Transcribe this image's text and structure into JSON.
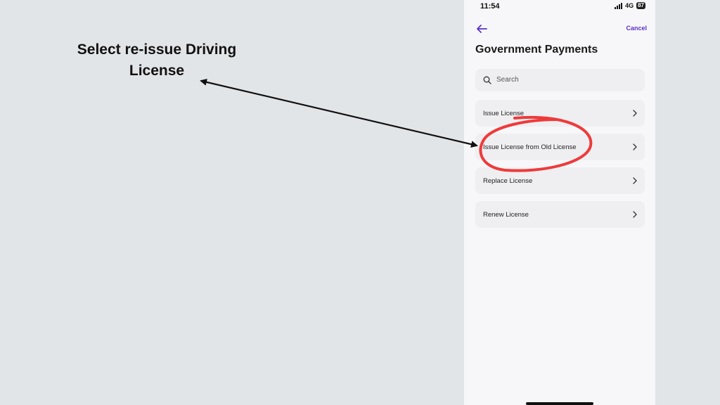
{
  "annotation": {
    "caption_line1": "Select re-issue Driving",
    "caption_line2": "License",
    "highlight_color": "#ef3a3a"
  },
  "status_bar": {
    "time": "11:54",
    "network": "4G",
    "battery": "87"
  },
  "header": {
    "back_icon": "arrow-left-icon",
    "cancel_label": "Cancel",
    "title": "Government Payments",
    "accent_color": "#5b2fc4"
  },
  "search": {
    "placeholder": "Search",
    "icon": "search-icon"
  },
  "services": [
    {
      "label": "Issue License"
    },
    {
      "label": "Issue License from Old License"
    },
    {
      "label": "Replace License"
    },
    {
      "label": "Renew License"
    }
  ]
}
